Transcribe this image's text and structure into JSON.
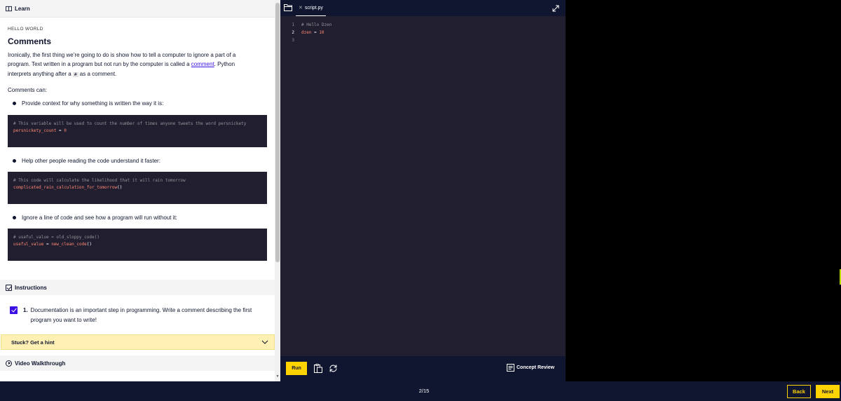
{
  "learn": {
    "header_label": "Learn",
    "eyebrow": "HELLO WORLD",
    "title": "Comments",
    "intro_1": "Ironically, the first thing we’re going to do is show how to tell a computer to ignore a part of a program. Text written in a program but not run by the computer is called a ",
    "intro_link": "comment",
    "intro_2": ". Python interprets anything after a ",
    "intro_code": "#",
    "intro_3": " as a comment.",
    "comments_can": "Comments can:",
    "bullets": [
      {
        "text": "Provide context for why something is written the way it is:",
        "comment": "# This variable will be used to count the number of times anyone tweets the word persnickety",
        "code_name": "persnickety_count",
        "code_op": " = ",
        "code_val": "0"
      },
      {
        "text": "Help other people reading the code understand it faster:",
        "comment": "# This code will calculate the likelihood that it will rain tomorrow",
        "code_name": "complicated_rain_calculation_for_tomorrow",
        "code_op": "()",
        "code_val": ""
      },
      {
        "text": "Ignore a line of code and see how a program will run without it:",
        "comment": "# useful_value = old_sloppy_code()",
        "code_name": "useful_value",
        "code_op": " = ",
        "code_val": "new_clean_code",
        "code_tail": "()"
      }
    ],
    "instructions_label": "Instructions",
    "task_number": "1.",
    "task_text": "Documentation is an important step in programming. Write a comment describing the first program you want to write!",
    "hint_label": "Stuck? Get a hint",
    "video_label": "Video Walkthrough"
  },
  "editor": {
    "file_tab": "script.py",
    "lines": [
      {
        "num": "1",
        "text": "# Hello Dzen"
      },
      {
        "num": "2",
        "name": "dzen",
        "op": " = ",
        "val": "10"
      },
      {
        "num": "3",
        "text": ""
      }
    ],
    "run_label": "Run",
    "concept_review_label": "Concept Review"
  },
  "footer": {
    "progress": "2/15",
    "back_label": "Back",
    "next_label": "Next"
  },
  "colors": {
    "accent_yellow": "#ffd300",
    "navy": "#10162f",
    "code_bg": "#211e2f",
    "link_blue": "#3a10e5",
    "code_orange": "#ff8973"
  }
}
